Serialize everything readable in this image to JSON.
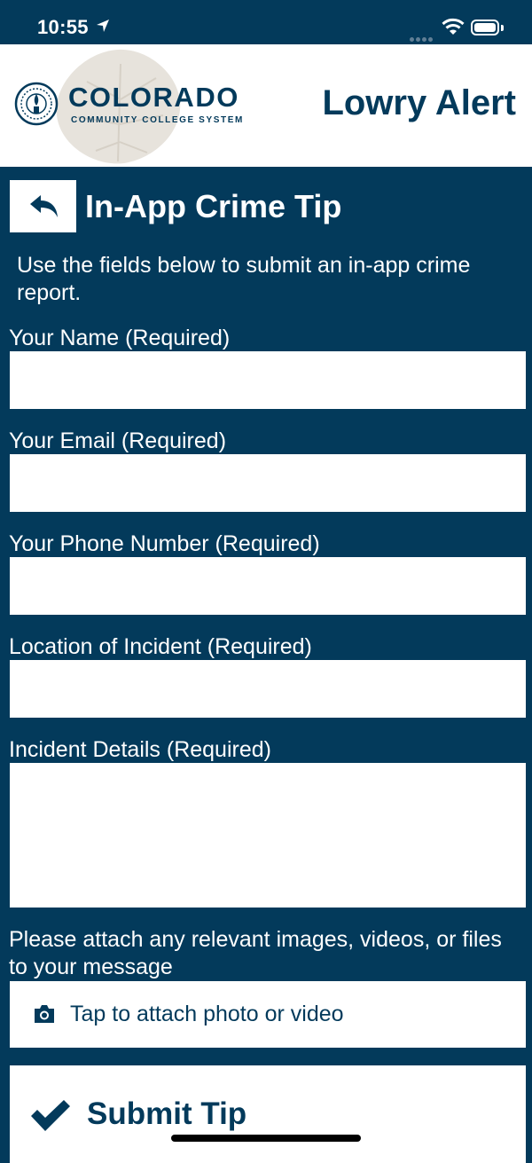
{
  "status_bar": {
    "time": "10:55"
  },
  "header": {
    "brand_title": "COLORADO",
    "brand_subtitle": "COMMUNITY COLLEGE SYSTEM",
    "app_title": "Lowry Alert"
  },
  "page": {
    "title": "In-App Crime Tip",
    "intro": "Use the fields below to submit an in-app crime report."
  },
  "form": {
    "name_label": "Your Name (Required)",
    "name_value": "",
    "email_label": "Your Email (Required)",
    "email_value": "",
    "phone_label": "Your Phone Number (Required)",
    "phone_value": "",
    "location_label": "Location of Incident (Required)",
    "location_value": "",
    "details_label": "Incident Details (Required)",
    "details_value": "",
    "attach_prompt": "Please attach any relevant images, videos, or files to your message",
    "attach_button": "Tap to attach photo or video",
    "submit_button": "Submit Tip"
  },
  "icons": {
    "location": "location-arrow-icon",
    "wifi": "wifi-icon",
    "battery": "battery-icon",
    "back": "back-arrow-icon",
    "camera": "camera-icon",
    "submit": "checkmark-icon"
  },
  "colors": {
    "primary": "#033a5b",
    "surface": "#ffffff"
  }
}
